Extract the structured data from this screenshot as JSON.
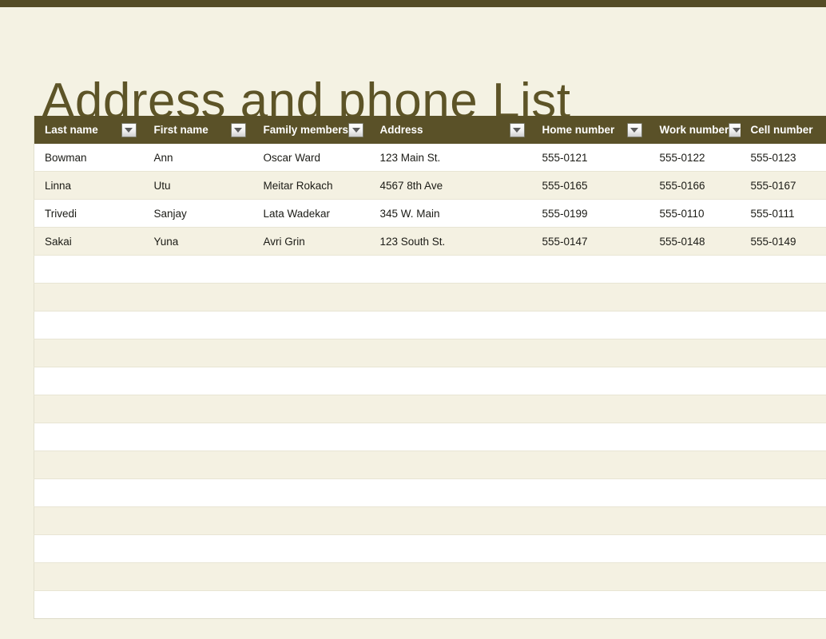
{
  "page": {
    "title": "Address and phone List",
    "accent_bar_color": "#544c26",
    "header_color": "#5a5128",
    "title_color": "#5d5427",
    "background_color": "#f4f2e3",
    "row_alt_color": "#f4f1e2"
  },
  "table": {
    "filter_icon": "filter-dropdown-icon",
    "columns": [
      {
        "key": "last_name",
        "label": "Last name",
        "has_filter": true
      },
      {
        "key": "first_name",
        "label": "First name",
        "has_filter": true
      },
      {
        "key": "family_members",
        "label": "Family members",
        "has_filter": true
      },
      {
        "key": "address",
        "label": "Address",
        "has_filter": true
      },
      {
        "key": "home_number",
        "label": "Home number",
        "has_filter": true
      },
      {
        "key": "work_number",
        "label": "Work number",
        "has_filter": true
      },
      {
        "key": "cell_number",
        "label": "Cell number",
        "has_filter": false
      }
    ],
    "rows": [
      {
        "last_name": "Bowman",
        "first_name": "Ann",
        "family_members": "Oscar Ward",
        "address": "123 Main St.",
        "home_number": "555-0121",
        "work_number": "555-0122",
        "cell_number": "555-0123"
      },
      {
        "last_name": "Linna",
        "first_name": "Utu",
        "family_members": "Meitar Rokach",
        "address": "4567 8th Ave",
        "home_number": "555-0165",
        "work_number": "555-0166",
        "cell_number": "555-0167"
      },
      {
        "last_name": "Trivedi",
        "first_name": "Sanjay",
        "family_members": "Lata Wadekar",
        "address": "345 W. Main",
        "home_number": "555-0199",
        "work_number": "555-0110",
        "cell_number": "555-0111"
      },
      {
        "last_name": "Sakai",
        "first_name": "Yuna",
        "family_members": "Avri Grin",
        "address": "123 South St.",
        "home_number": "555-0147",
        "work_number": "555-0148",
        "cell_number": "555-0149"
      },
      {
        "last_name": "",
        "first_name": "",
        "family_members": "",
        "address": "",
        "home_number": "",
        "work_number": "",
        "cell_number": ""
      },
      {
        "last_name": "",
        "first_name": "",
        "family_members": "",
        "address": "",
        "home_number": "",
        "work_number": "",
        "cell_number": ""
      },
      {
        "last_name": "",
        "first_name": "",
        "family_members": "",
        "address": "",
        "home_number": "",
        "work_number": "",
        "cell_number": ""
      },
      {
        "last_name": "",
        "first_name": "",
        "family_members": "",
        "address": "",
        "home_number": "",
        "work_number": "",
        "cell_number": ""
      },
      {
        "last_name": "",
        "first_name": "",
        "family_members": "",
        "address": "",
        "home_number": "",
        "work_number": "",
        "cell_number": ""
      },
      {
        "last_name": "",
        "first_name": "",
        "family_members": "",
        "address": "",
        "home_number": "",
        "work_number": "",
        "cell_number": ""
      },
      {
        "last_name": "",
        "first_name": "",
        "family_members": "",
        "address": "",
        "home_number": "",
        "work_number": "",
        "cell_number": ""
      },
      {
        "last_name": "",
        "first_name": "",
        "family_members": "",
        "address": "",
        "home_number": "",
        "work_number": "",
        "cell_number": ""
      },
      {
        "last_name": "",
        "first_name": "",
        "family_members": "",
        "address": "",
        "home_number": "",
        "work_number": "",
        "cell_number": ""
      },
      {
        "last_name": "",
        "first_name": "",
        "family_members": "",
        "address": "",
        "home_number": "",
        "work_number": "",
        "cell_number": ""
      },
      {
        "last_name": "",
        "first_name": "",
        "family_members": "",
        "address": "",
        "home_number": "",
        "work_number": "",
        "cell_number": ""
      },
      {
        "last_name": "",
        "first_name": "",
        "family_members": "",
        "address": "",
        "home_number": "",
        "work_number": "",
        "cell_number": ""
      },
      {
        "last_name": "",
        "first_name": "",
        "family_members": "",
        "address": "",
        "home_number": "",
        "work_number": "",
        "cell_number": ""
      }
    ]
  }
}
